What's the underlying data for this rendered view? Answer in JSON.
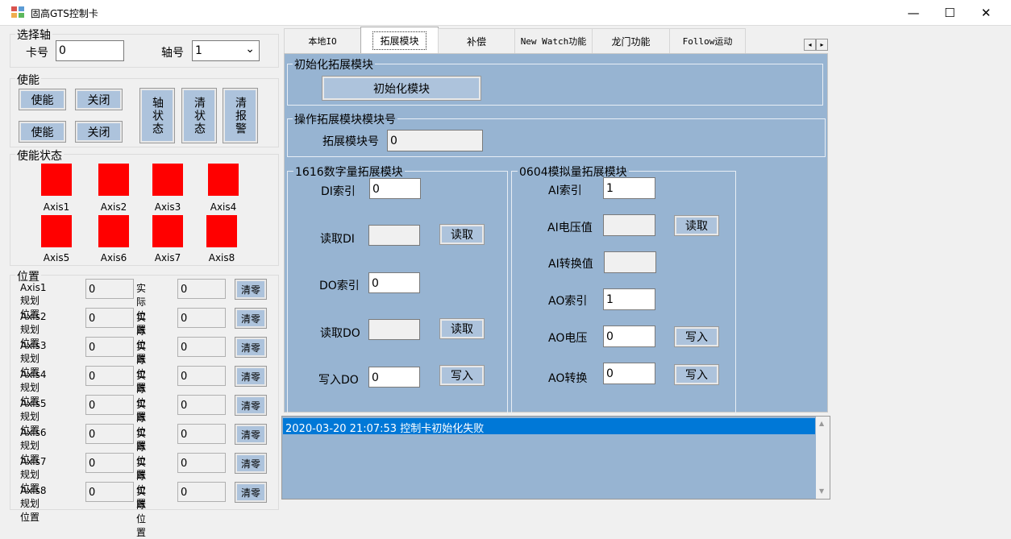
{
  "window": {
    "title": "固高GTS控制卡",
    "minimize": "—",
    "maximize": "☐",
    "close": "✕"
  },
  "select_axis": {
    "group": "选择轴",
    "card_label": "卡号",
    "card_value": "0",
    "axis_label": "轴号",
    "axis_value": "1",
    "dropdown_glyph": "⌄"
  },
  "enable": {
    "group": "使能",
    "enable_btn": "使能",
    "disable_btn": "关闭",
    "axis_status_btn": "轴状态",
    "clear_status_btn": "清状态",
    "clear_alarm_btn": "清报警"
  },
  "enable_status": {
    "group": "使能状态",
    "axes": [
      "Axis1",
      "Axis2",
      "Axis3",
      "Axis4",
      "Axis5",
      "Axis6",
      "Axis7",
      "Axis8"
    ],
    "led_color": "#ff0000"
  },
  "position": {
    "group": "位置",
    "actual_label": "实际位置",
    "clear_btn": "清零",
    "rows": [
      {
        "label": "Axis1规划位置",
        "plan": "0",
        "actual": "0"
      },
      {
        "label": "Axis2规划位置",
        "plan": "0",
        "actual": "0"
      },
      {
        "label": "Axis3规划位置",
        "plan": "0",
        "actual": "0"
      },
      {
        "label": "Axis4规划位置",
        "plan": "0",
        "actual": "0"
      },
      {
        "label": "Axis5规划位置",
        "plan": "0",
        "actual": "0"
      },
      {
        "label": "Axis6规划位置",
        "plan": "0",
        "actual": "0"
      },
      {
        "label": "Axis7规划位置",
        "plan": "0",
        "actual": "0"
      },
      {
        "label": "Axis8规划位置",
        "plan": "0",
        "actual": "0"
      }
    ]
  },
  "tabs": [
    "本地IO",
    "拓展模块",
    "补偿",
    "New Watch功能",
    "龙门功能",
    "Follow运动"
  ],
  "tab_scroll": {
    "left": "◂",
    "right": "▸"
  },
  "ext": {
    "init_group": "初始化拓展模块",
    "init_btn": "初始化模块",
    "op_group": "操作拓展模块模块号",
    "module_label": "拓展模块号",
    "module_value": "0",
    "digital_group": "1616数字量拓展模块",
    "di_index_label": "DI索引",
    "di_index_value": "0",
    "read_di_label": "读取DI",
    "read_di_value": "",
    "do_index_label": "DO索引",
    "do_index_value": "0",
    "read_do_label": "读取DO",
    "read_do_value": "",
    "write_do_label": "写入DO",
    "write_do_value": "0",
    "read_btn": "读取",
    "write_btn": "写入",
    "analog_group": "0604模拟量拓展模块",
    "ai_index_label": "AI索引",
    "ai_index_value": "1",
    "ai_voltage_label": "AI电压值",
    "ai_voltage_value": "",
    "ai_convert_label": "AI转换值",
    "ai_convert_value": "",
    "ao_index_label": "AO索引",
    "ao_index_value": "1",
    "ao_voltage_label": "AO电压",
    "ao_voltage_value": "0",
    "ao_convert_label": "AO转换",
    "ao_convert_value": "0"
  },
  "log": {
    "entries": [
      "2020-03-20 21:07:53 控制卡初始化失败"
    ],
    "up": "▲",
    "down": "▼"
  }
}
